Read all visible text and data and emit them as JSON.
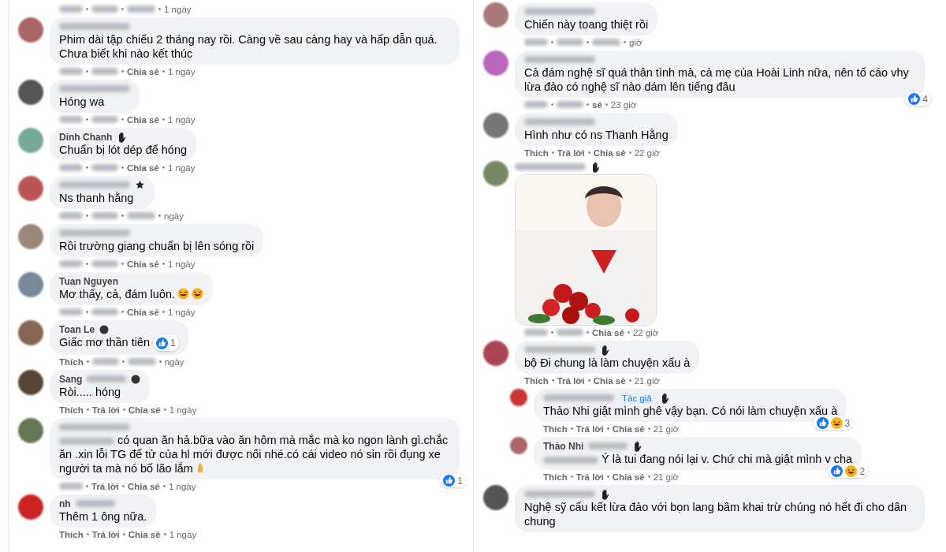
{
  "columns": [
    {
      "comments": [
        {
          "kind": "meta",
          "meta": {
            "time": "1 ngày"
          }
        },
        {
          "kind": "comment",
          "name_blurred": true,
          "text": "Phim dài tập chiếu 2 tháng nay rồi. Càng về sau càng hay và hấp dẫn quá. Chưa biết khi nào kết thúc",
          "meta": {
            "share": "Chia sẻ",
            "time": "1 ngày"
          }
        },
        {
          "kind": "comment",
          "name_blurred": true,
          "text": "Hóng wa",
          "meta": {
            "share": "Chia sẻ",
            "time": "1 ngày"
          }
        },
        {
          "kind": "comment",
          "name": "Dinh Chanh",
          "badge": {
            "kind": "hand"
          },
          "text": "Chuẩn bị lót dép để hóng",
          "meta": {
            "share": "Chia sẻ",
            "time": "1 ngày"
          }
        },
        {
          "kind": "comment",
          "name_blurred": true,
          "badge": {
            "kind": "star"
          },
          "text": "Ns thanh hằng",
          "meta": {
            "time": "ngày"
          }
        },
        {
          "kind": "comment",
          "name_blurred": true,
          "text": "Rồi trường giang chuẩn bị lên sóng rồi",
          "meta": {
            "share": "Chia sẻ",
            "time": "1 ngày"
          }
        },
        {
          "kind": "comment",
          "name": "Tuan Nguyen",
          "text": "Mơ thấy, cả, đám luôn.",
          "emojis": [
            {
              "kind": "laugh"
            },
            {
              "kind": "laugh"
            }
          ],
          "meta": {
            "share": "Chia sẻ",
            "time": "1 ngày"
          }
        },
        {
          "kind": "comment",
          "name": "Toan Le",
          "badge": {
            "kind": "dot"
          },
          "text": "Giấc mơ thần tiên",
          "inline_reaction": {
            "types": [
              {
                "kind": "like"
              }
            ],
            "count": "1"
          },
          "meta": {
            "like": "Thích",
            "time": "ngày"
          }
        },
        {
          "kind": "comment",
          "name": "Sang",
          "name_blurred": true,
          "badge": {
            "kind": "dot"
          },
          "text": "Ròi..... hóng",
          "meta": {
            "like": "Thích",
            "reply": "Trả lời",
            "share": "Chia sẻ",
            "time": "1 ngày"
          }
        },
        {
          "kind": "comment",
          "name_blurred": true,
          "blurred_prefix": true,
          "text": "có quan ăn hả.bữa vào ăn hôm mà mắc mà ko ngon lành gì.chắc ăn .xin lỗi TG để tử của hl mới được nổi nhé.có cái video nó sỉn rồi đụng xe người ta mà nó bố lão lắm",
          "emojis": [
            {
              "kind": "pray"
            }
          ],
          "reaction": {
            "types": [
              {
                "kind": "like"
              }
            ],
            "count": "1"
          },
          "meta": {
            "reply": "Trả lời",
            "share": "Chia sẻ",
            "time": "1 ngày"
          }
        },
        {
          "kind": "comment",
          "name": "nh",
          "name_blurred": true,
          "text": "Thêm 1 ông nữa.",
          "meta": {
            "like": "Thích",
            "reply": "Trả lời",
            "share": "Chia sẻ",
            "time": "1 ngày"
          }
        }
      ]
    },
    {
      "comments": [
        {
          "kind": "comment",
          "name_blurred": true,
          "text": "Chiến này toang thiệt rồi",
          "meta": {
            "time": "giờ"
          }
        },
        {
          "kind": "comment",
          "name_blurred": true,
          "text": "Cả đám nghệ sĩ quá thân tình mà, cả mẹ của Hoài Linh nữa, nên tố cáo vhy lừa đảo có nghệ sĩ nào dám lên tiếng đâu",
          "reaction": {
            "types": [
              {
                "kind": "like"
              }
            ],
            "count": "4"
          },
          "meta": {
            "share": "sẻ",
            "time": "23 giờ"
          }
        },
        {
          "kind": "comment",
          "name_blurred": true,
          "text": "Hình như có ns Thanh Hằng",
          "meta": {
            "like": "Thích",
            "reply": "Trả lời",
            "share": "Chia sẻ",
            "time": "22 giờ"
          }
        },
        {
          "name_blurred": true,
          "badge": {
            "kind": "hand"
          },
          "meta": {
            "share": "Chia sẻ",
            "time": "22 giờ"
          }
        },
        {
          "kind": "comment",
          "name_blurred": true,
          "badge": {
            "kind": "hand"
          },
          "text": "bộ Đi chung là làm chuyện xấu à",
          "meta": {
            "like": "Thích",
            "reply": "Trả lời",
            "share": "Chia sẻ",
            "time": "21 giờ"
          },
          "replies": [
            {
              "kind": "comment",
              "name_blurred": true,
              "author_tag": "Tác giả",
              "badge": {
                "kind": "hand"
              },
              "text": "Thảo Nhi giật mình ghê vậy bạn. Có nói làm chuyện xấu à",
              "reaction": {
                "types": [
                  {
                    "kind": "like"
                  },
                  {
                    "kind": "haha"
                  }
                ],
                "count": "3"
              },
              "meta": {
                "like": "Thích",
                "reply": "Trả lời",
                "share": "Chia sẻ",
                "time": "21 giờ"
              }
            },
            {
              "kind": "comment",
              "name": "Thảo Nhi",
              "name_blurred": true,
              "badge": {
                "kind": "hand"
              },
              "blurred_prefix": true,
              "text": "Ý là tui đang nói lại v. Chứ chi mà giật mình v cha",
              "reaction": {
                "types": [
                  {
                    "kind": "like"
                  },
                  {
                    "kind": "haha"
                  }
                ],
                "count": "2"
              },
              "meta": {
                "like": "Thích",
                "reply": "Trả lời",
                "share": "Chia sẻ",
                "time": "21 giờ"
              }
            }
          ]
        },
        {
          "kind": "comment",
          "name_blurred": true,
          "badge": {
            "kind": "hand"
          },
          "text": "Nghệ sỹ cấu kết lừa đảo với bọn lang bâm khai trừ chúng nó hết đi cho dân chung"
        }
      ]
    }
  ]
}
